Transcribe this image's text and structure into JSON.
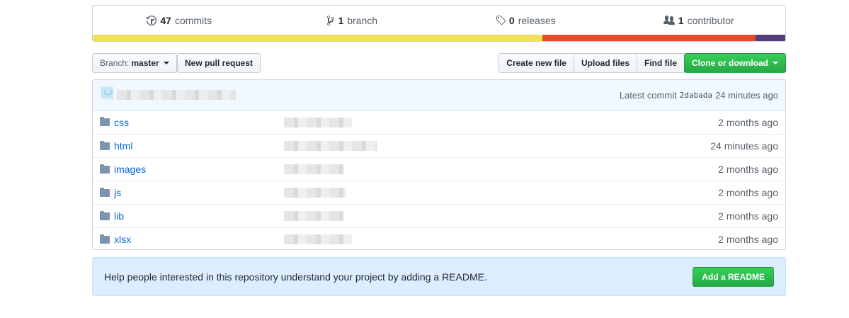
{
  "summary": {
    "commits": {
      "count": "47",
      "label": "commits",
      "icon": "history-icon"
    },
    "branches": {
      "count": "1",
      "label": "branch",
      "icon": "git-branch-icon"
    },
    "releases": {
      "count": "0",
      "label": "releases",
      "icon": "tag-icon"
    },
    "contributors": {
      "count": "1",
      "label": "contributor",
      "icon": "people-icon"
    }
  },
  "language_bar": [
    {
      "color": "#f1e05a",
      "percent": 64.9
    },
    {
      "color": "#e34c26",
      "percent": 30.8
    },
    {
      "color": "#563d7c",
      "percent": 4.3
    }
  ],
  "toolbar": {
    "branch_prefix": "Branch:",
    "branch_name": "master",
    "new_pr": "New pull request",
    "create_file": "Create new file",
    "upload_files": "Upload files",
    "find_file": "Find file",
    "clone": "Clone or download"
  },
  "commit_tease": {
    "prefix": "Latest commit",
    "sha": "2dabada",
    "age": "24 minutes ago"
  },
  "files": [
    {
      "name": "css",
      "age": "2 months ago"
    },
    {
      "name": "html",
      "age": "24 minutes ago"
    },
    {
      "name": "images",
      "age": "2 months ago"
    },
    {
      "name": "js",
      "age": "2 months ago"
    },
    {
      "name": "lib",
      "age": "2 months ago"
    },
    {
      "name": "xlsx",
      "age": "2 months ago"
    }
  ],
  "readme": {
    "text": "Help people interested in this repository understand your project by adding a README.",
    "button": "Add a README"
  }
}
